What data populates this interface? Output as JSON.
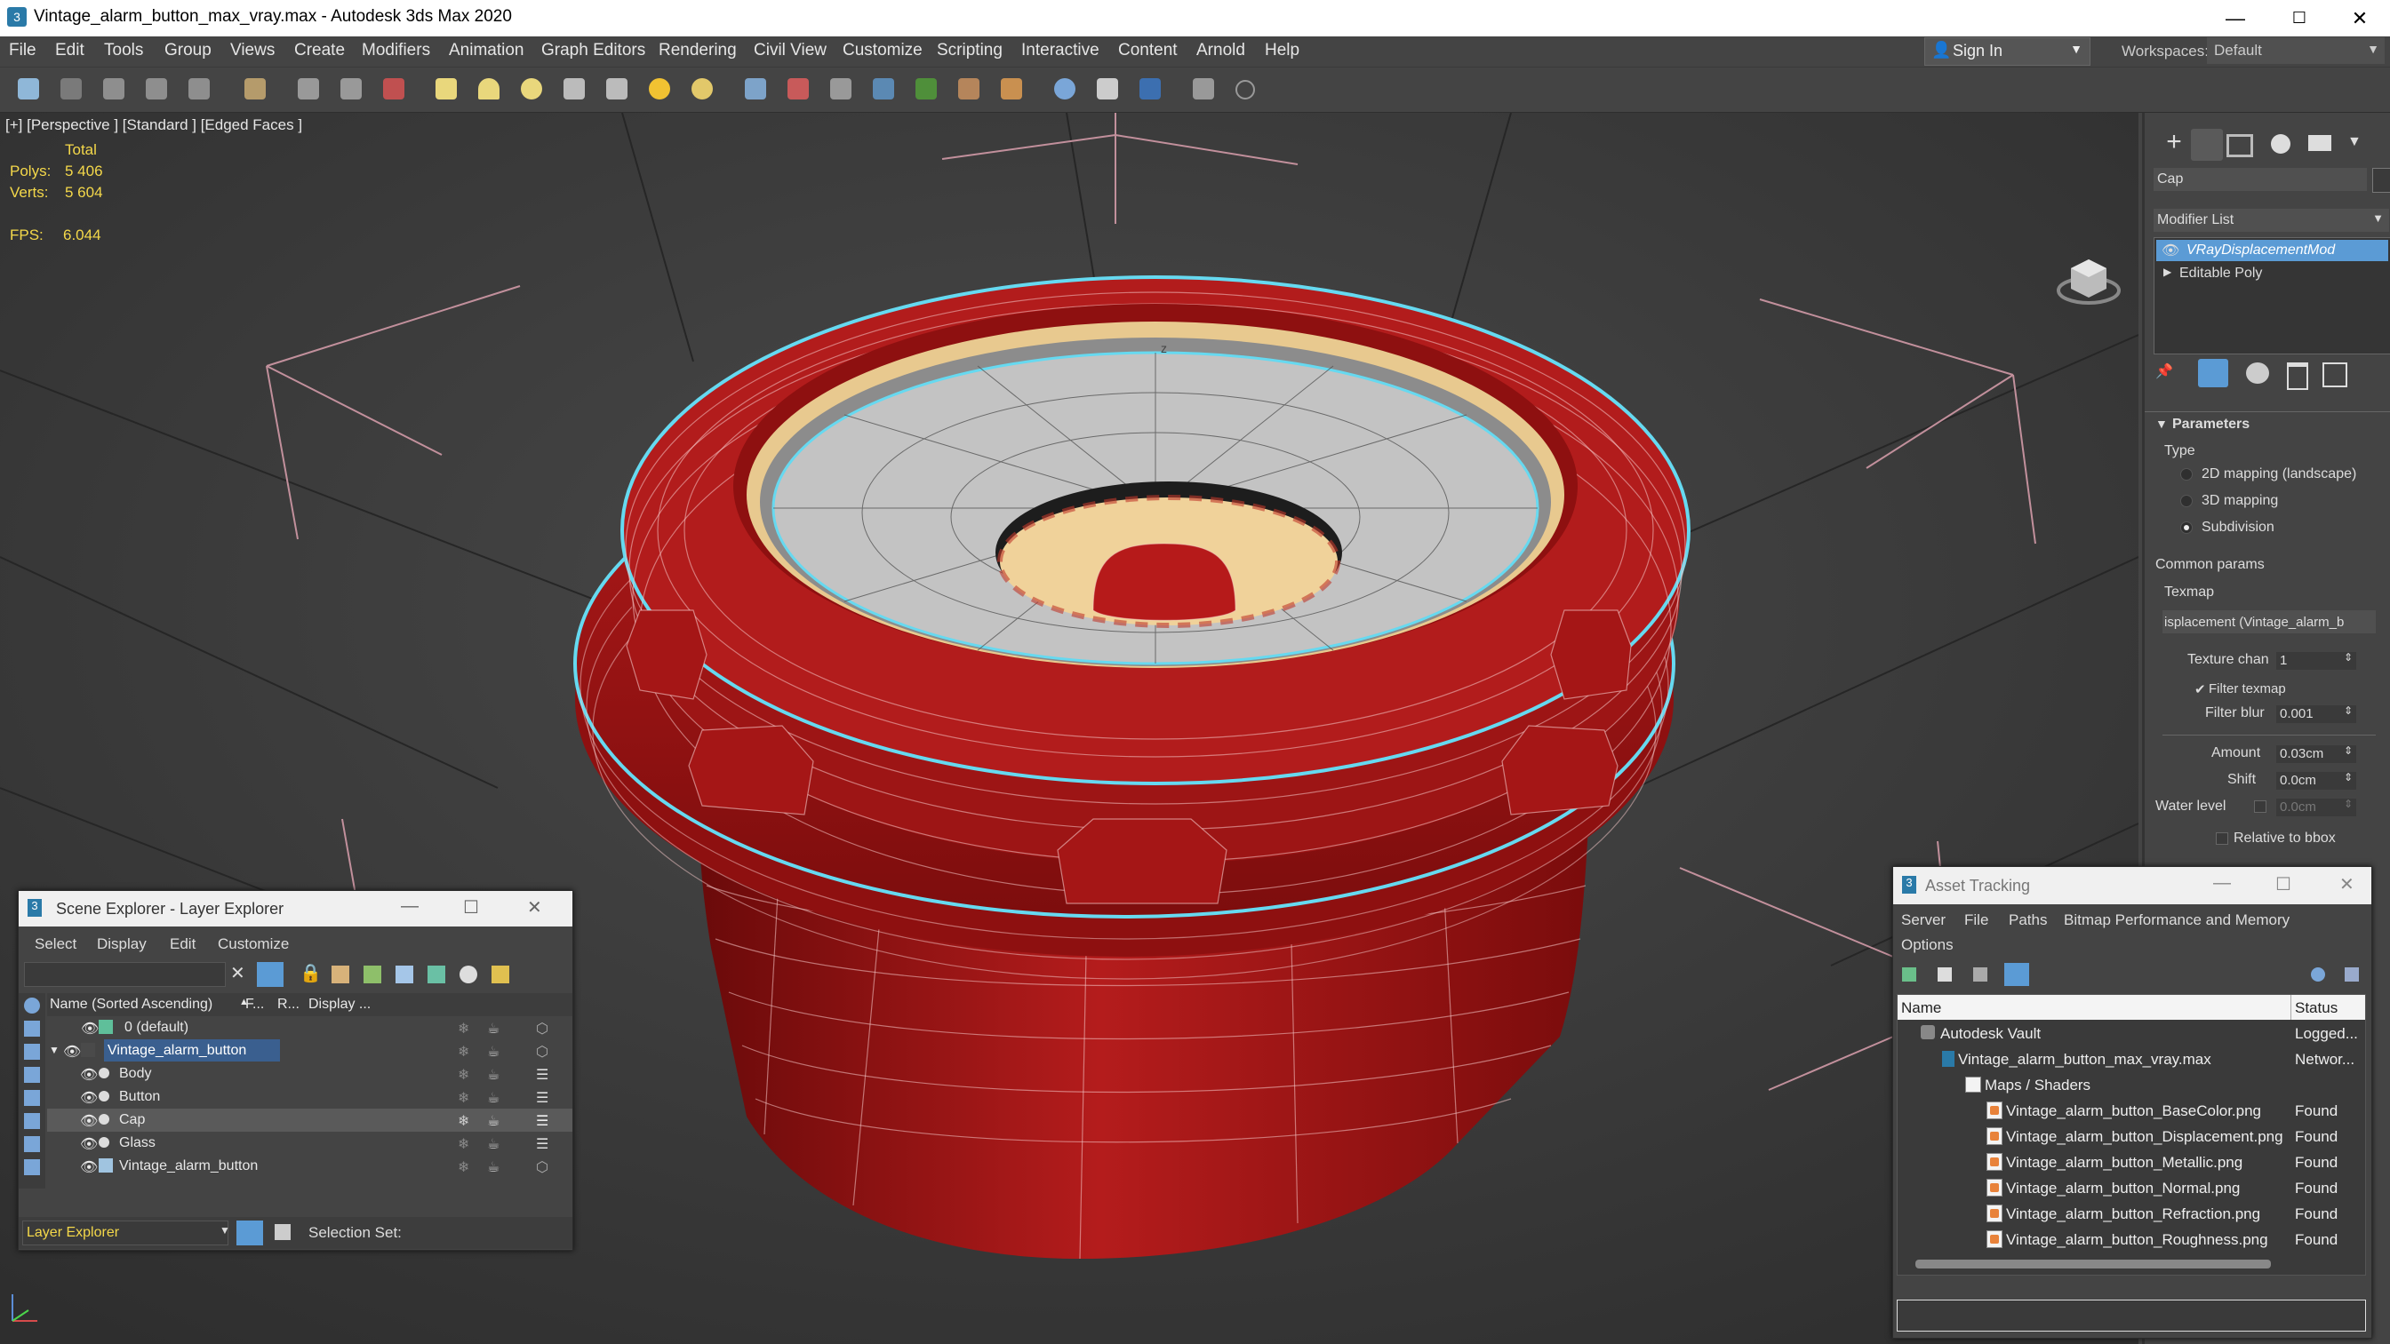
{
  "window": {
    "title": "Vintage_alarm_button_max_vray.max - Autodesk 3ds Max 2020",
    "controls": [
      "—",
      "☐",
      "✕"
    ]
  },
  "menu": [
    "File",
    "Edit",
    "Tools",
    "Group",
    "Views",
    "Create",
    "Modifiers",
    "Animation",
    "Graph Editors",
    "Rendering",
    "Civil View",
    "Customize",
    "Scripting",
    "Interactive",
    "Content",
    "Arnold",
    "Help"
  ],
  "account": {
    "sign_in": "Sign In",
    "workspaces_label": "Workspaces:",
    "workspace": "Default"
  },
  "viewport": {
    "label": "[+] [Perspective ] [Standard ] [Edged Faces ]",
    "stats": {
      "total_label": "Total",
      "polys_label": "Polys:",
      "polys": "5 406",
      "verts_label": "Verts:",
      "verts": "5 604",
      "fps_label": "FPS:",
      "fps": "6.044"
    },
    "axis": {
      "x": "x",
      "y": "y",
      "z": "z"
    }
  },
  "command_panel": {
    "object_name": "Cap",
    "modifier_list_label": "Modifier List",
    "modifiers": [
      "VRayDisplacementMod",
      "Editable Poly"
    ],
    "rollout_title": "Parameters",
    "type_label": "Type",
    "type_options": [
      "2D mapping (landscape)",
      "3D mapping",
      "Subdivision"
    ],
    "type_selected": "Subdivision",
    "common_params": "Common params",
    "texmap_label": "Texmap",
    "texmap_value": "isplacement (Vintage_alarm_b",
    "texture_chan_label": "Texture chan",
    "texture_chan": "1",
    "filter_texmap": "Filter texmap",
    "filter_blur_label": "Filter blur",
    "filter_blur": "0.001",
    "amount_label": "Amount",
    "amount": "0.03cm",
    "shift_label": "Shift",
    "shift": "0.0cm",
    "water_level_label": "Water level",
    "water_level": "0.0cm",
    "relative_bbox": "Relative to bbox"
  },
  "scene_explorer": {
    "title": "Scene Explorer - Layer Explorer",
    "menu": [
      "Select",
      "Display",
      "Edit",
      "Customize"
    ],
    "columns": [
      "Name (Sorted Ascending)",
      "F...",
      "R...",
      "Display ..."
    ],
    "rows": [
      {
        "name": "0 (default)"
      },
      {
        "name": "Vintage_alarm_button"
      },
      {
        "name": "Body"
      },
      {
        "name": "Button"
      },
      {
        "name": "Cap"
      },
      {
        "name": "Glass"
      },
      {
        "name": "Vintage_alarm_button"
      }
    ],
    "footer_dropdown": "Layer Explorer",
    "selection_set_label": "Selection Set:"
  },
  "asset_tracking": {
    "title": "Asset Tracking",
    "menu": [
      "Server",
      "File",
      "Paths",
      "Bitmap Performance and Memory",
      "Options"
    ],
    "columns": [
      "Name",
      "Status"
    ],
    "rows": [
      {
        "name": "Autodesk Vault",
        "status": "Logged..."
      },
      {
        "name": "Vintage_alarm_button_max_vray.max",
        "status": "Networ..."
      },
      {
        "name": "Maps / Shaders",
        "status": ""
      },
      {
        "name": "Vintage_alarm_button_BaseColor.png",
        "status": "Found"
      },
      {
        "name": "Vintage_alarm_button_Displacement.png",
        "status": "Found"
      },
      {
        "name": "Vintage_alarm_button_Metallic.png",
        "status": "Found"
      },
      {
        "name": "Vintage_alarm_button_Normal.png",
        "status": "Found"
      },
      {
        "name": "Vintage_alarm_button_Refraction.png",
        "status": "Found"
      },
      {
        "name": "Vintage_alarm_button_Roughness.png",
        "status": "Found"
      }
    ]
  },
  "colors": {
    "accent": "#5b9bd5",
    "selection_outline": "#66d9f0",
    "model_red": "#a31414",
    "stat_yellow": "#f4d84a"
  }
}
